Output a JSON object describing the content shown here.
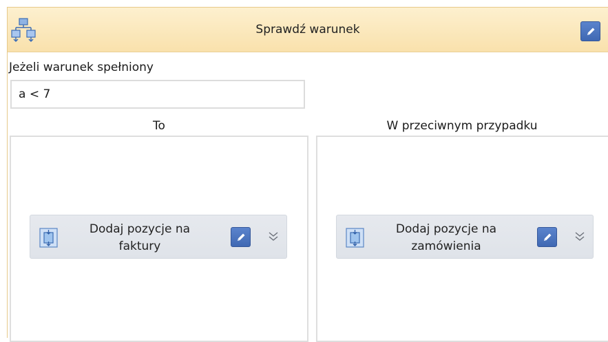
{
  "header": {
    "title": "Sprawdź warunek",
    "icon": "condition-flow-icon",
    "edit_icon": "pencil-icon"
  },
  "condition": {
    "label": "Jeżeli warunek spełniony",
    "value": "a < 7"
  },
  "branches": {
    "then": {
      "title": "To",
      "action": {
        "label": "Dodaj pozycje na\nfaktury",
        "icon": "document-transfer-icon"
      }
    },
    "else": {
      "title": "W przeciwnym przypadku",
      "action": {
        "label": "Dodaj pozycje na\nzamówienia",
        "icon": "document-transfer-icon"
      }
    }
  },
  "colors": {
    "header_bg": "#f9e1ac",
    "accent_button": "#4a72bd",
    "action_bg": "#e3e6eb"
  }
}
